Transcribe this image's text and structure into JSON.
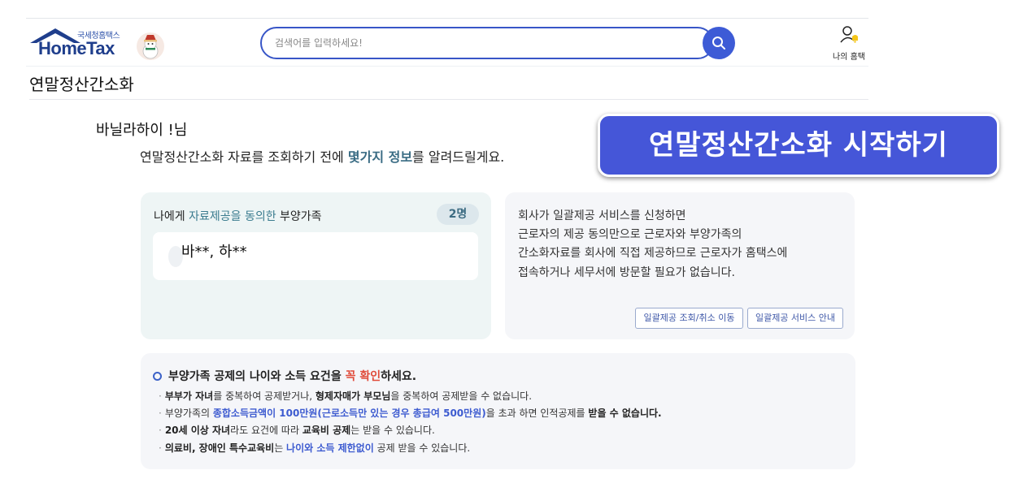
{
  "header": {
    "logo_small": "국세청홈택스",
    "logo_main": "HomeTax",
    "search_placeholder": "검색어를 입력하세요!",
    "my_label": "나의 홈택"
  },
  "page": {
    "title": "연말정산간소화",
    "user_name": "바닐라하이 !님",
    "intro_pre": "연말정산간소화 자료를 조회하기 전에 ",
    "intro_hl": "몇가지 정보",
    "intro_post": "를 알려드릴게요.",
    "start_button": "연말정산간소화 시작하기"
  },
  "dependents_card": {
    "title_pre": "나에게 ",
    "title_hl": "자료제공을 동의한",
    "title_post": " 부양가족",
    "count": "2명",
    "names": "바**, 하**"
  },
  "info_card": {
    "lines": [
      "회사가 일괄제공 서비스를 신청하면",
      "근로자의 제공 동의만으로 근로자와 부양가족의",
      "간소화자료를 회사에 직접 제공하므로 근로자가 홈택스에",
      "접속하거나 세무서에 방문할 필요가 없습니다."
    ],
    "btn_lookup": "일괄제공 조회/취소 이동",
    "btn_guide": "일괄제공 서비스 안내"
  },
  "notice": {
    "title_pre": "부양가족 공제의 나이와 소득 요건을 ",
    "title_red": "꼭 확인",
    "title_post": "하세요.",
    "l1_b1": "부부가 자녀",
    "l1_t1": "를 중복하여 공제받거나, ",
    "l1_b2": "형제자매가 부모님",
    "l1_t2": "을 중복하여 공제받을 수 없습니다.",
    "l2_t1": "부양가족의 ",
    "l2_blue": "종합소득금액이 100만원(근로소득만 있는 경우 총급여 500만원)",
    "l2_t2": "을 초과 하면 인적공제를 ",
    "l2_b": "받을 수 없습니다.",
    "l3_b1": "20세 이상 자녀",
    "l3_t1": "라도 요건에 따라 ",
    "l3_b2": "교육비 공제",
    "l3_t2": "는 받을 수 있습니다.",
    "l4_b1": "의료비, 장애인 특수교육비",
    "l4_t1": "는 ",
    "l4_blue": "나이와 소득 제한없이",
    "l4_t2": " 공제 받을 수 있습니다."
  },
  "colors": {
    "accent": "#4556d8",
    "highlight_teal": "#3a7b8e",
    "warning_red": "#e04b3a"
  }
}
